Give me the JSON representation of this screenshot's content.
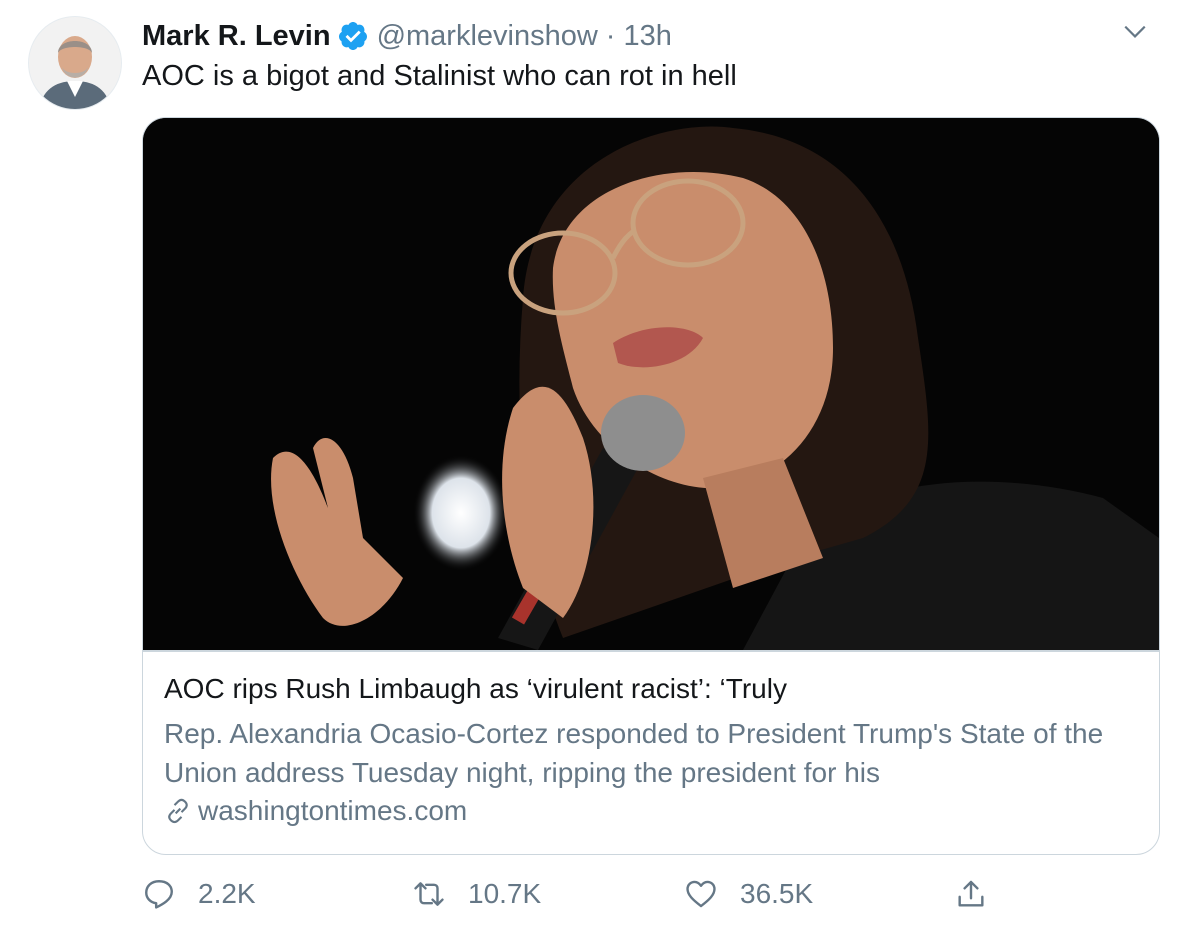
{
  "tweet": {
    "author": {
      "name": "Mark R. Levin",
      "handle": "@marklevinshow",
      "verified": true,
      "avatar_icon": "user-avatar-photo"
    },
    "separator": "·",
    "time": "13h",
    "text": "AOC is a bigot and Stalinist who can rot in hell",
    "menu_icon": "chevron-down-icon"
  },
  "card": {
    "image_icon": "article-photo",
    "title": "AOC rips Rush Limbaugh as ‘virulent racist’: ‘Truly",
    "description": "Rep. Alexandria Ocasio-Cortez responded to President Trump's State of the Union address Tuesday night, ripping the president for his",
    "domain": "washingtontimes.com",
    "domain_icon": "link-icon"
  },
  "actions": {
    "reply": {
      "icon": "reply-icon",
      "count": "2.2K"
    },
    "retweet": {
      "icon": "retweet-icon",
      "count": "10.7K"
    },
    "like": {
      "icon": "heart-icon",
      "count": "36.5K"
    },
    "share": {
      "icon": "share-icon"
    }
  },
  "colors": {
    "accent": "#1da1f2",
    "secondary_text": "#657786",
    "border": "#ccd6dd",
    "primary_text": "#14171a"
  }
}
